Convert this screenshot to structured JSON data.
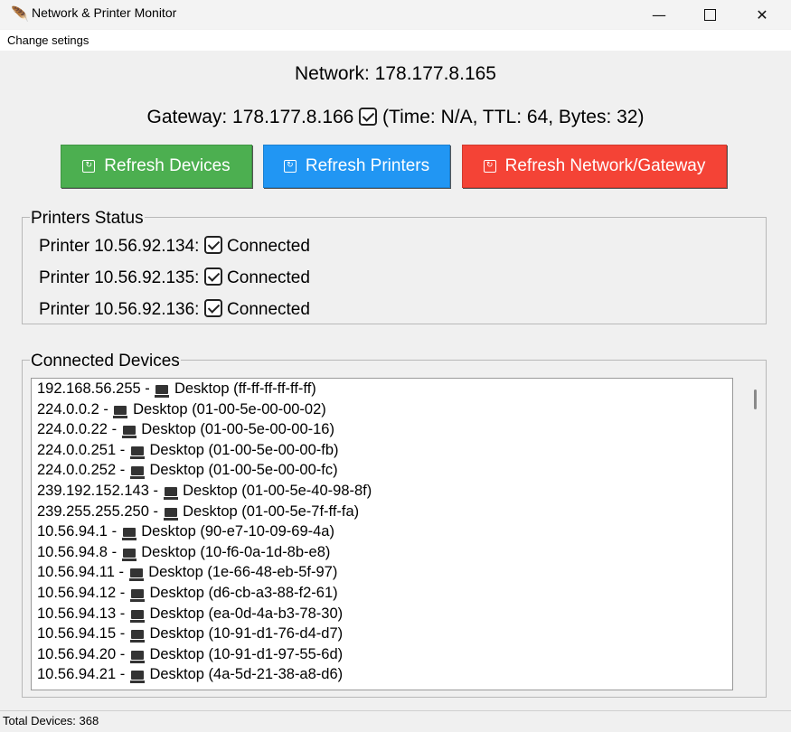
{
  "window": {
    "title": "Network & Printer Monitor"
  },
  "menu": {
    "item": "Change setings"
  },
  "network": {
    "text": "Network: 178.177.8.165"
  },
  "gateway": {
    "prefix": "Gateway: 178.177.8.166",
    "details": "(Time: N/A, TTL: 64, Bytes: 32)"
  },
  "buttons": {
    "refresh_devices": "Refresh Devices",
    "refresh_printers": "Refresh Printers",
    "refresh_network": "Refresh Network/Gateway"
  },
  "colors": {
    "devices_btn": "#4caf50",
    "printers_btn": "#2196f3",
    "network_btn": "#f44336"
  },
  "printers": {
    "title": "Printers Status",
    "items": [
      {
        "name": "Printer 10.56.92.134:",
        "status": "Connected"
      },
      {
        "name": "Printer 10.56.92.135:",
        "status": "Connected"
      },
      {
        "name": "Printer 10.56.92.136:",
        "status": "Connected"
      }
    ]
  },
  "devices": {
    "title": "Connected Devices",
    "items": [
      {
        "ip": "192.168.56.255 -",
        "label": "Desktop (ff-ff-ff-ff-ff-ff)"
      },
      {
        "ip": "224.0.0.2 -",
        "label": "Desktop (01-00-5e-00-00-02)"
      },
      {
        "ip": "224.0.0.22 -",
        "label": "Desktop (01-00-5e-00-00-16)"
      },
      {
        "ip": "224.0.0.251 -",
        "label": "Desktop (01-00-5e-00-00-fb)"
      },
      {
        "ip": "224.0.0.252 -",
        "label": "Desktop (01-00-5e-00-00-fc)"
      },
      {
        "ip": "239.192.152.143 -",
        "label": "Desktop (01-00-5e-40-98-8f)"
      },
      {
        "ip": "239.255.255.250 -",
        "label": "Desktop (01-00-5e-7f-ff-fa)"
      },
      {
        "ip": "10.56.94.1 -",
        "label": "Desktop (90-e7-10-09-69-4a)"
      },
      {
        "ip": "10.56.94.8 -",
        "label": "Desktop (10-f6-0a-1d-8b-e8)"
      },
      {
        "ip": "10.56.94.11 -",
        "label": "Desktop (1e-66-48-eb-5f-97)"
      },
      {
        "ip": "10.56.94.12 -",
        "label": "Desktop (d6-cb-a3-88-f2-61)"
      },
      {
        "ip": "10.56.94.13 -",
        "label": "Desktop (ea-0d-4a-b3-78-30)"
      },
      {
        "ip": "10.56.94.15 -",
        "label": "Desktop (10-91-d1-76-d4-d7)"
      },
      {
        "ip": "10.56.94.20 -",
        "label": "Desktop (10-91-d1-97-55-6d)"
      },
      {
        "ip": "10.56.94.21 -",
        "label": "Desktop (4a-5d-21-38-a8-d6)"
      }
    ]
  },
  "status": {
    "total": "Total Devices: 368"
  }
}
